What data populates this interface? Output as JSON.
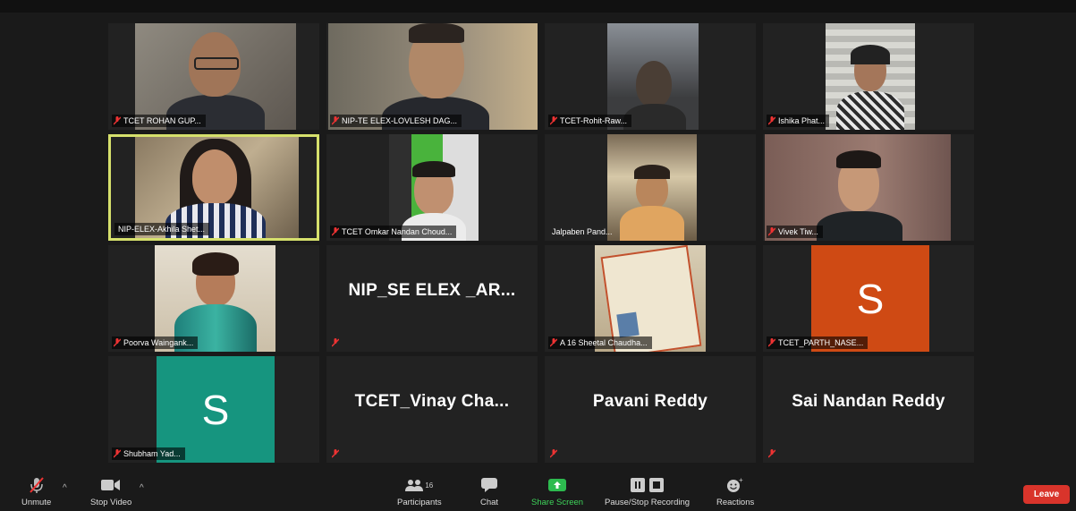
{
  "participants": [
    {
      "name": "TCET ROHAN GUP..."
    },
    {
      "name": "NIP-TE ELEX-LOVLESH DAG..."
    },
    {
      "name": "TCET-Rohit-Raw..."
    },
    {
      "name": "Ishika Phat..."
    },
    {
      "name": "NIP-ELEX-Akhila Shet..."
    },
    {
      "name": "TCET Omkar Nandan Choud..."
    },
    {
      "name": "Jalpaben Pand..."
    },
    {
      "name": "Vivek Tiw..."
    },
    {
      "name": "Poorva Waingank..."
    },
    {
      "name": "NIP_SE ELEX _AR..."
    },
    {
      "name": "A 16 Sheetal Chaudha..."
    },
    {
      "name": "TCET_PARTH_NASE...",
      "avatar_letter": "S"
    },
    {
      "name": "Shubham Yad...",
      "avatar_letter": "S"
    },
    {
      "name": "TCET_Vinay Cha..."
    },
    {
      "name": "Pavani Reddy"
    },
    {
      "name": "Sai Nandan Reddy"
    }
  ],
  "toolbar": {
    "unmute": "Unmute",
    "stop_video": "Stop Video",
    "participants": "Participants",
    "participants_count": "16",
    "chat": "Chat",
    "share_screen": "Share Screen",
    "recording": "Pause/Stop Recording",
    "reactions": "Reactions",
    "leave": "Leave"
  },
  "colors": {
    "active_speaker_border": "#d6e06c",
    "share_screen_green": "#2dbb4f",
    "leave_red": "#d9342b",
    "avatar_orange": "#cf4a14",
    "avatar_teal": "#16957f"
  }
}
